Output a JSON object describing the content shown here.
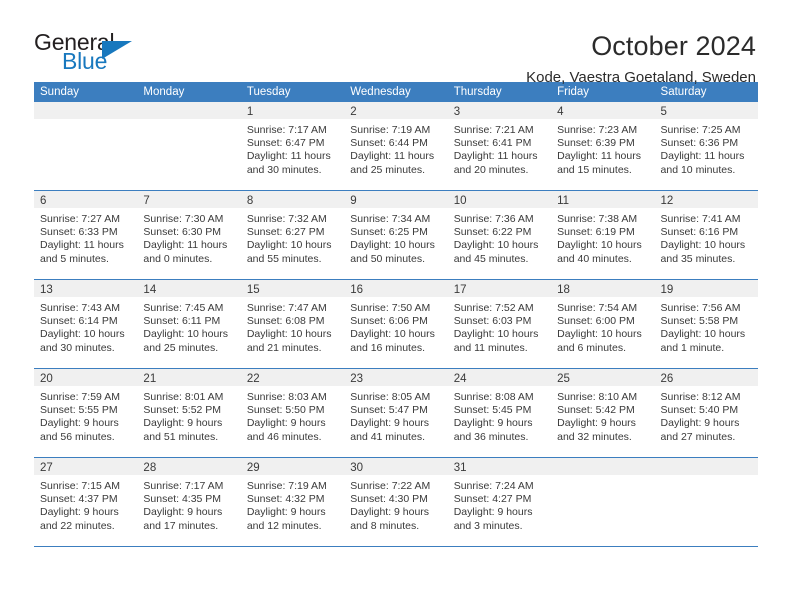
{
  "brand": {
    "name_part1": "General",
    "name_part2": "Blue",
    "accent_color": "#1878be"
  },
  "header": {
    "title": "October 2024",
    "subtitle": "Kode, Vaestra Goetaland, Sweden"
  },
  "calendar": {
    "header_color": "#3c7ebf",
    "weekdays": [
      "Sunday",
      "Monday",
      "Tuesday",
      "Wednesday",
      "Thursday",
      "Friday",
      "Saturday"
    ],
    "weeks": [
      [
        {
          "day": "",
          "lines": []
        },
        {
          "day": "",
          "lines": []
        },
        {
          "day": "1",
          "lines": [
            "Sunrise: 7:17 AM",
            "Sunset: 6:47 PM",
            "Daylight: 11 hours",
            "and 30 minutes."
          ]
        },
        {
          "day": "2",
          "lines": [
            "Sunrise: 7:19 AM",
            "Sunset: 6:44 PM",
            "Daylight: 11 hours",
            "and 25 minutes."
          ]
        },
        {
          "day": "3",
          "lines": [
            "Sunrise: 7:21 AM",
            "Sunset: 6:41 PM",
            "Daylight: 11 hours",
            "and 20 minutes."
          ]
        },
        {
          "day": "4",
          "lines": [
            "Sunrise: 7:23 AM",
            "Sunset: 6:39 PM",
            "Daylight: 11 hours",
            "and 15 minutes."
          ]
        },
        {
          "day": "5",
          "lines": [
            "Sunrise: 7:25 AM",
            "Sunset: 6:36 PM",
            "Daylight: 11 hours",
            "and 10 minutes."
          ]
        }
      ],
      [
        {
          "day": "6",
          "lines": [
            "Sunrise: 7:27 AM",
            "Sunset: 6:33 PM",
            "Daylight: 11 hours",
            "and 5 minutes."
          ]
        },
        {
          "day": "7",
          "lines": [
            "Sunrise: 7:30 AM",
            "Sunset: 6:30 PM",
            "Daylight: 11 hours",
            "and 0 minutes."
          ]
        },
        {
          "day": "8",
          "lines": [
            "Sunrise: 7:32 AM",
            "Sunset: 6:27 PM",
            "Daylight: 10 hours",
            "and 55 minutes."
          ]
        },
        {
          "day": "9",
          "lines": [
            "Sunrise: 7:34 AM",
            "Sunset: 6:25 PM",
            "Daylight: 10 hours",
            "and 50 minutes."
          ]
        },
        {
          "day": "10",
          "lines": [
            "Sunrise: 7:36 AM",
            "Sunset: 6:22 PM",
            "Daylight: 10 hours",
            "and 45 minutes."
          ]
        },
        {
          "day": "11",
          "lines": [
            "Sunrise: 7:38 AM",
            "Sunset: 6:19 PM",
            "Daylight: 10 hours",
            "and 40 minutes."
          ]
        },
        {
          "day": "12",
          "lines": [
            "Sunrise: 7:41 AM",
            "Sunset: 6:16 PM",
            "Daylight: 10 hours",
            "and 35 minutes."
          ]
        }
      ],
      [
        {
          "day": "13",
          "lines": [
            "Sunrise: 7:43 AM",
            "Sunset: 6:14 PM",
            "Daylight: 10 hours",
            "and 30 minutes."
          ]
        },
        {
          "day": "14",
          "lines": [
            "Sunrise: 7:45 AM",
            "Sunset: 6:11 PM",
            "Daylight: 10 hours",
            "and 25 minutes."
          ]
        },
        {
          "day": "15",
          "lines": [
            "Sunrise: 7:47 AM",
            "Sunset: 6:08 PM",
            "Daylight: 10 hours",
            "and 21 minutes."
          ]
        },
        {
          "day": "16",
          "lines": [
            "Sunrise: 7:50 AM",
            "Sunset: 6:06 PM",
            "Daylight: 10 hours",
            "and 16 minutes."
          ]
        },
        {
          "day": "17",
          "lines": [
            "Sunrise: 7:52 AM",
            "Sunset: 6:03 PM",
            "Daylight: 10 hours",
            "and 11 minutes."
          ]
        },
        {
          "day": "18",
          "lines": [
            "Sunrise: 7:54 AM",
            "Sunset: 6:00 PM",
            "Daylight: 10 hours",
            "and 6 minutes."
          ]
        },
        {
          "day": "19",
          "lines": [
            "Sunrise: 7:56 AM",
            "Sunset: 5:58 PM",
            "Daylight: 10 hours",
            "and 1 minute."
          ]
        }
      ],
      [
        {
          "day": "20",
          "lines": [
            "Sunrise: 7:59 AM",
            "Sunset: 5:55 PM",
            "Daylight: 9 hours",
            "and 56 minutes."
          ]
        },
        {
          "day": "21",
          "lines": [
            "Sunrise: 8:01 AM",
            "Sunset: 5:52 PM",
            "Daylight: 9 hours",
            "and 51 minutes."
          ]
        },
        {
          "day": "22",
          "lines": [
            "Sunrise: 8:03 AM",
            "Sunset: 5:50 PM",
            "Daylight: 9 hours",
            "and 46 minutes."
          ]
        },
        {
          "day": "23",
          "lines": [
            "Sunrise: 8:05 AM",
            "Sunset: 5:47 PM",
            "Daylight: 9 hours",
            "and 41 minutes."
          ]
        },
        {
          "day": "24",
          "lines": [
            "Sunrise: 8:08 AM",
            "Sunset: 5:45 PM",
            "Daylight: 9 hours",
            "and 36 minutes."
          ]
        },
        {
          "day": "25",
          "lines": [
            "Sunrise: 8:10 AM",
            "Sunset: 5:42 PM",
            "Daylight: 9 hours",
            "and 32 minutes."
          ]
        },
        {
          "day": "26",
          "lines": [
            "Sunrise: 8:12 AM",
            "Sunset: 5:40 PM",
            "Daylight: 9 hours",
            "and 27 minutes."
          ]
        }
      ],
      [
        {
          "day": "27",
          "lines": [
            "Sunrise: 7:15 AM",
            "Sunset: 4:37 PM",
            "Daylight: 9 hours",
            "and 22 minutes."
          ]
        },
        {
          "day": "28",
          "lines": [
            "Sunrise: 7:17 AM",
            "Sunset: 4:35 PM",
            "Daylight: 9 hours",
            "and 17 minutes."
          ]
        },
        {
          "day": "29",
          "lines": [
            "Sunrise: 7:19 AM",
            "Sunset: 4:32 PM",
            "Daylight: 9 hours",
            "and 12 minutes."
          ]
        },
        {
          "day": "30",
          "lines": [
            "Sunrise: 7:22 AM",
            "Sunset: 4:30 PM",
            "Daylight: 9 hours",
            "and 8 minutes."
          ]
        },
        {
          "day": "31",
          "lines": [
            "Sunrise: 7:24 AM",
            "Sunset: 4:27 PM",
            "Daylight: 9 hours",
            "and 3 minutes."
          ]
        },
        {
          "day": "",
          "lines": []
        },
        {
          "day": "",
          "lines": []
        }
      ]
    ]
  }
}
